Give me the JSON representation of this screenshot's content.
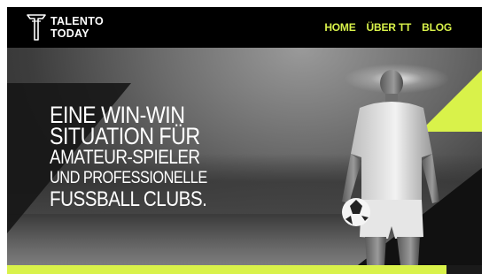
{
  "header": {
    "logo": {
      "line1": "TALENTO",
      "line2": "TODAY",
      "icon": "tt-logo-icon"
    },
    "nav": [
      {
        "label": "HOME"
      },
      {
        "label": "ÜBER TT"
      },
      {
        "label": "BLOG"
      }
    ]
  },
  "hero": {
    "headline": [
      "EINE WIN-WIN",
      "SITUATION FÜR",
      "AMATEUR-SPIELER",
      "UND PROFESSIONELLE",
      "FUSSBALL CLUBS."
    ],
    "image": "football-player-stadium-photo"
  },
  "colors": {
    "accent": "#d9f24a",
    "header_bg": "#000000",
    "text": "#ffffff"
  }
}
